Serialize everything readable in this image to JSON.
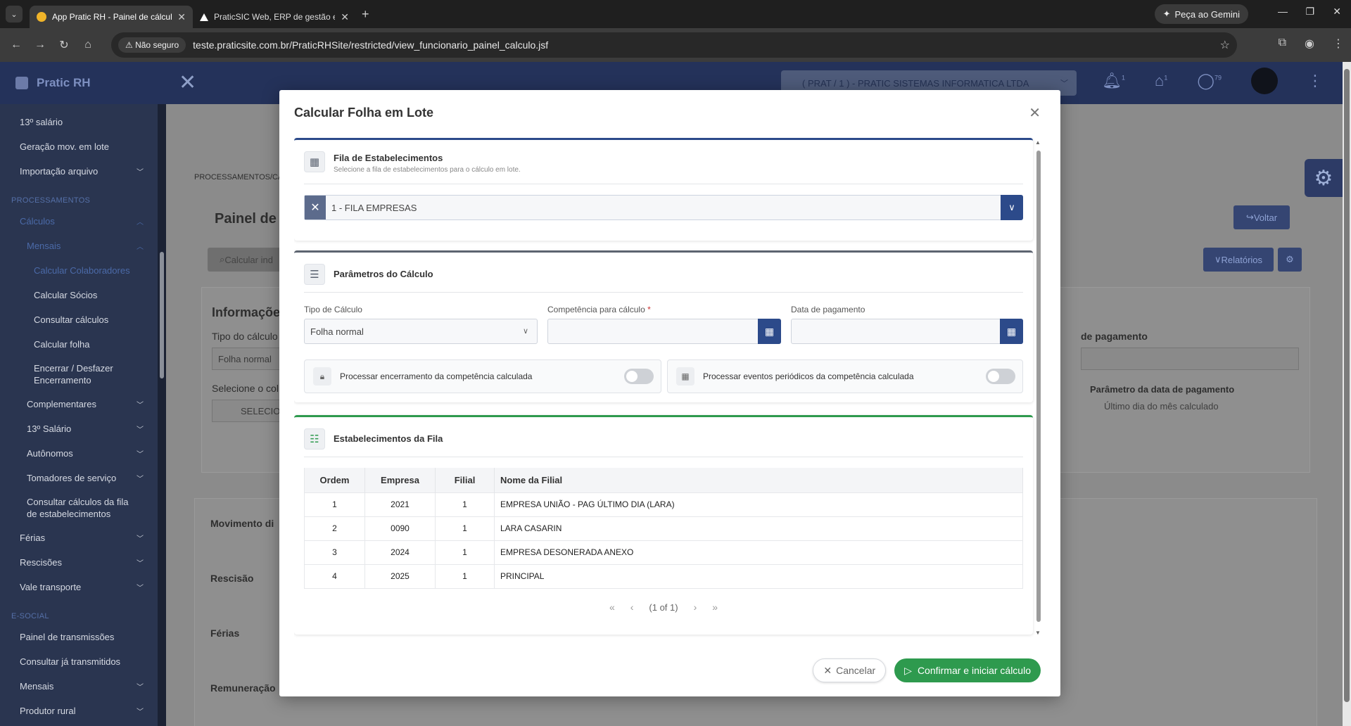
{
  "browser": {
    "tabs": [
      {
        "title": "App Pratic RH - Painel de cálculo"
      },
      {
        "title": "PraticSIC Web, ERP de gestão e"
      }
    ],
    "gemini_label": "Peça ao Gemini",
    "insecure_label": "Não seguro",
    "url": "teste.praticsite.com.br/PraticRHSite/restricted/view_funcionario_painel_calculo.jsf"
  },
  "app": {
    "brand": "Pratic RH",
    "company": "( PRAT / 1 ) - PRATIC SISTEMAS INFORMATICA LTDA",
    "badges": {
      "notifications": "1",
      "tags": "1",
      "messages": "79"
    }
  },
  "sidebar": {
    "items_top": [
      {
        "label": "13º salário",
        "chevron": false
      },
      {
        "label": "Geração mov. em lote",
        "chevron": false
      },
      {
        "label": "Importação arquivo",
        "chevron": true
      }
    ],
    "section_processamentos": "PROCESSAMENTOS",
    "calculos": "Cálculos",
    "mensais": "Mensais",
    "mensais_items": [
      "Calcular Colaboradores",
      "Calcular Sócios",
      "Consultar cálculos",
      "Calcular folha",
      "Encerrar / Desfazer Encerramento"
    ],
    "items_mid": [
      "Complementares",
      "13º Salário",
      "Autônomos",
      "Tomadores de serviço"
    ],
    "consultar_fila": "Consultar cálculos da fila de estabelecimentos",
    "items_bottom": [
      "Férias",
      "Rescisões",
      "Vale transporte"
    ],
    "section_esocial": "E-SOCIAL",
    "esocial_items": [
      {
        "label": "Painel de transmissões",
        "chevron": false
      },
      {
        "label": "Consultar já transmitidos",
        "chevron": false
      },
      {
        "label": "Mensais",
        "chevron": true
      },
      {
        "label": "Produtor rural",
        "chevron": true
      }
    ]
  },
  "background": {
    "breadcrumb": "PROCESSAMENTOS/CÁ",
    "page_title": "Painel de",
    "voltar": "Voltar",
    "relatorios": "Relatórios",
    "calc_ind": "Calcular ind",
    "info_title": "Informaçõe",
    "tipo_label": "Tipo do cálculo",
    "tipo_value": "Folha normal",
    "selecione": "Selecione o col",
    "selecion_input": "SELECION",
    "data_pag": "de pagamento",
    "param_data": "Parâmetro da data de pagamento",
    "ultimo_dia": "Último dia do mês calculado",
    "panels": [
      "Movimento di",
      "Rescisão",
      "Férias",
      "Remuneração"
    ]
  },
  "modal": {
    "title": "Calcular Folha em Lote",
    "fila": {
      "title": "Fila de Estabelecimentos",
      "subtitle": "Selecione a fila de estabelecimentos para o cálculo em lote.",
      "selected": "1 - FILA EMPRESAS"
    },
    "params": {
      "title": "Parâmetros do Cálculo",
      "tipo_label": "Tipo de Cálculo",
      "tipo_value": "Folha normal",
      "competencia_label": "Competência para cálculo",
      "required_mark": "*",
      "data_label": "Data de pagamento",
      "toggle1": "Processar encerramento da competência calculada",
      "toggle2": "Processar eventos periódicos da competência calculada"
    },
    "estab": {
      "title": "Estabelecimentos da Fila",
      "headers": [
        "Ordem",
        "Empresa",
        "Filial",
        "Nome da Filial"
      ],
      "rows": [
        [
          "1",
          "2021",
          "1",
          "EMPRESA UNIÃO - PAG ÚLTIMO DIA (LARA)"
        ],
        [
          "2",
          "0090",
          "1",
          "LARA CASARIN"
        ],
        [
          "3",
          "2024",
          "1",
          "EMPRESA DESONERADA ANEXO"
        ],
        [
          "4",
          "2025",
          "1",
          "PRINCIPAL"
        ]
      ],
      "pager_info": "(1 of 1)"
    },
    "cancel": "Cancelar",
    "confirm": "Confirmar e iniciar cálculo"
  }
}
